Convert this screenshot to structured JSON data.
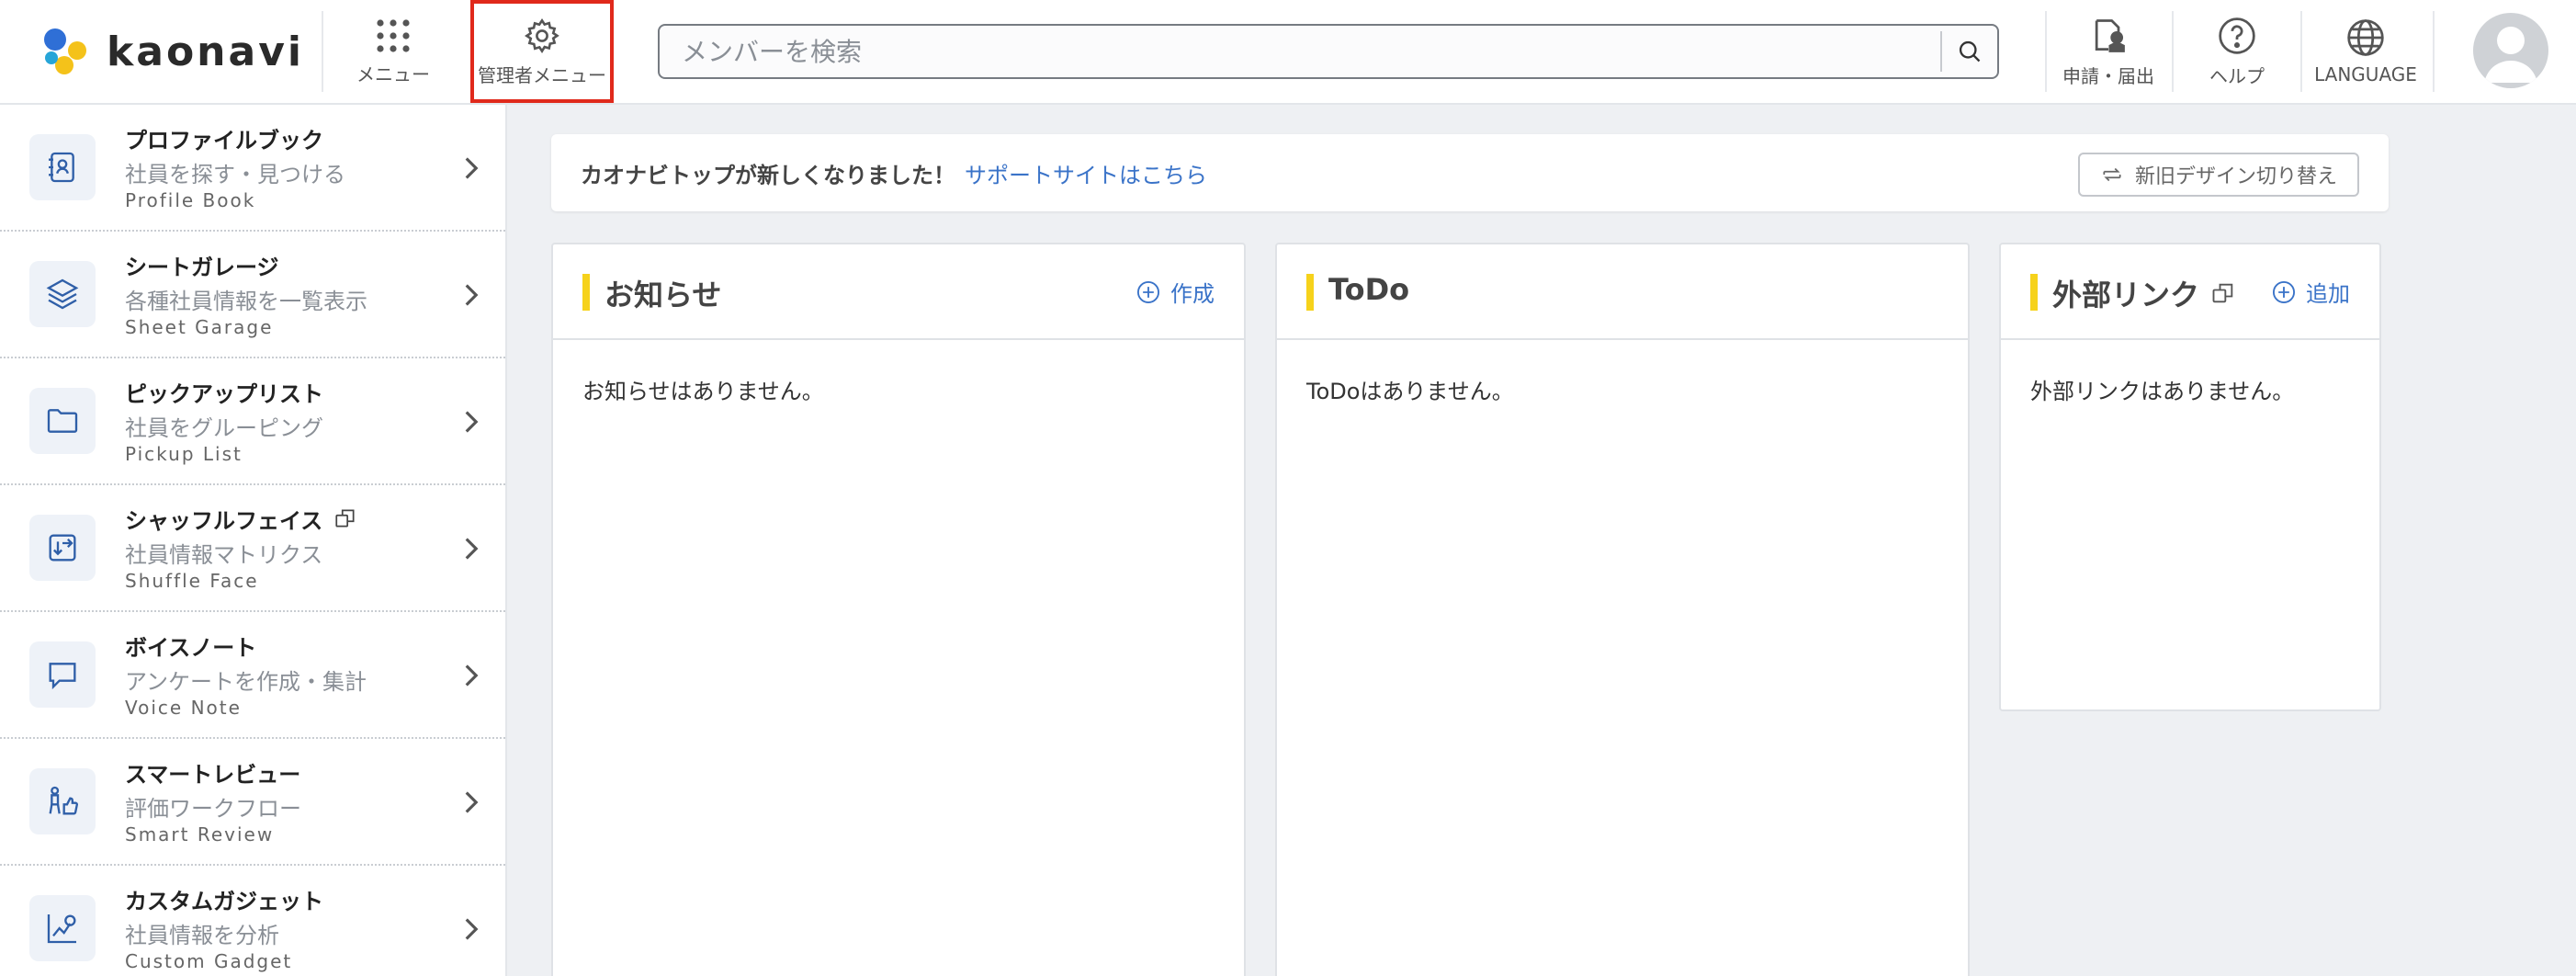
{
  "header": {
    "logo_text": "kaonavi",
    "menu_label": "メニュー",
    "admin_menu_label": "管理者メニュー",
    "search_placeholder": "メンバーを検索",
    "request_label": "申請・届出",
    "help_label": "ヘルプ",
    "language_label": "LANGUAGE"
  },
  "sidebar": {
    "items": [
      {
        "title": "プロファイルブック",
        "subtitle": "社員を探す・見つける",
        "english": "Profile Book",
        "icon": "profile-book-icon"
      },
      {
        "title": "シートガレージ",
        "subtitle": "各種社員情報を一覧表示",
        "english": "Sheet Garage",
        "icon": "layers-icon"
      },
      {
        "title": "ピックアップリスト",
        "subtitle": "社員をグルーピング",
        "english": "Pickup List",
        "icon": "folder-icon"
      },
      {
        "title": "シャッフルフェイス",
        "subtitle": "社員情報マトリクス",
        "english": "Shuffle Face",
        "icon": "shuffle-icon",
        "external": true
      },
      {
        "title": "ボイスノート",
        "subtitle": "アンケートを作成・集計",
        "english": "Voice Note",
        "icon": "speech-bubble-icon"
      },
      {
        "title": "スマートレビュー",
        "subtitle": "評価ワークフロー",
        "english": "Smart Review",
        "icon": "thumbs-up-icon"
      },
      {
        "title": "カスタムガジェット",
        "subtitle": "社員情報を分析",
        "english": "Custom Gadget",
        "icon": "chart-icon"
      }
    ]
  },
  "banner": {
    "text": "カオナビトップが新しくなりました！",
    "link": "サポートサイトはこちら",
    "switch_label": "新旧デザイン切り替え"
  },
  "panels": {
    "notices": {
      "title": "お知らせ",
      "action": "作成",
      "empty": "お知らせはありません。"
    },
    "todo": {
      "title": "ToDo",
      "empty": "ToDoはありません。"
    },
    "links": {
      "title": "外部リンク",
      "action": "追加",
      "empty": "外部リンクはありません。"
    }
  },
  "colors": {
    "accent_blue": "#3a73c8",
    "section_bar": "#f6d21b",
    "admin_highlight": "#e0291b",
    "background": "#eef0f3"
  }
}
